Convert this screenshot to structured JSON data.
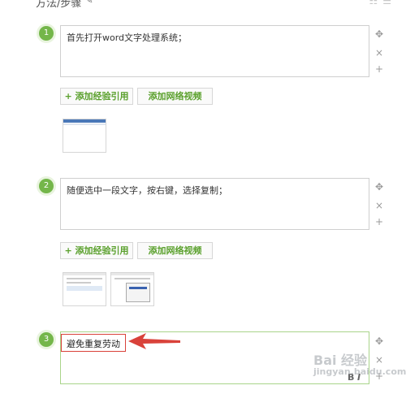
{
  "header": {
    "title": "方法/步骤"
  },
  "steps": [
    {
      "number": "1",
      "text": "首先打开word文字处理系统；"
    },
    {
      "number": "2",
      "text": "随便选中一段文字，按右键，选择复制；"
    },
    {
      "number": "3",
      "text": "避免重复劳动"
    }
  ],
  "buttons": {
    "add_experience": "+ 添加经验引用",
    "add_video": "添加网络视频"
  },
  "controls": {
    "move": "✥",
    "delete": "×",
    "add": "+"
  },
  "format": {
    "bold": "B",
    "italic": "I"
  },
  "watermark": {
    "brand": "Bai 经验",
    "url": "jingyan.baidu.com"
  }
}
